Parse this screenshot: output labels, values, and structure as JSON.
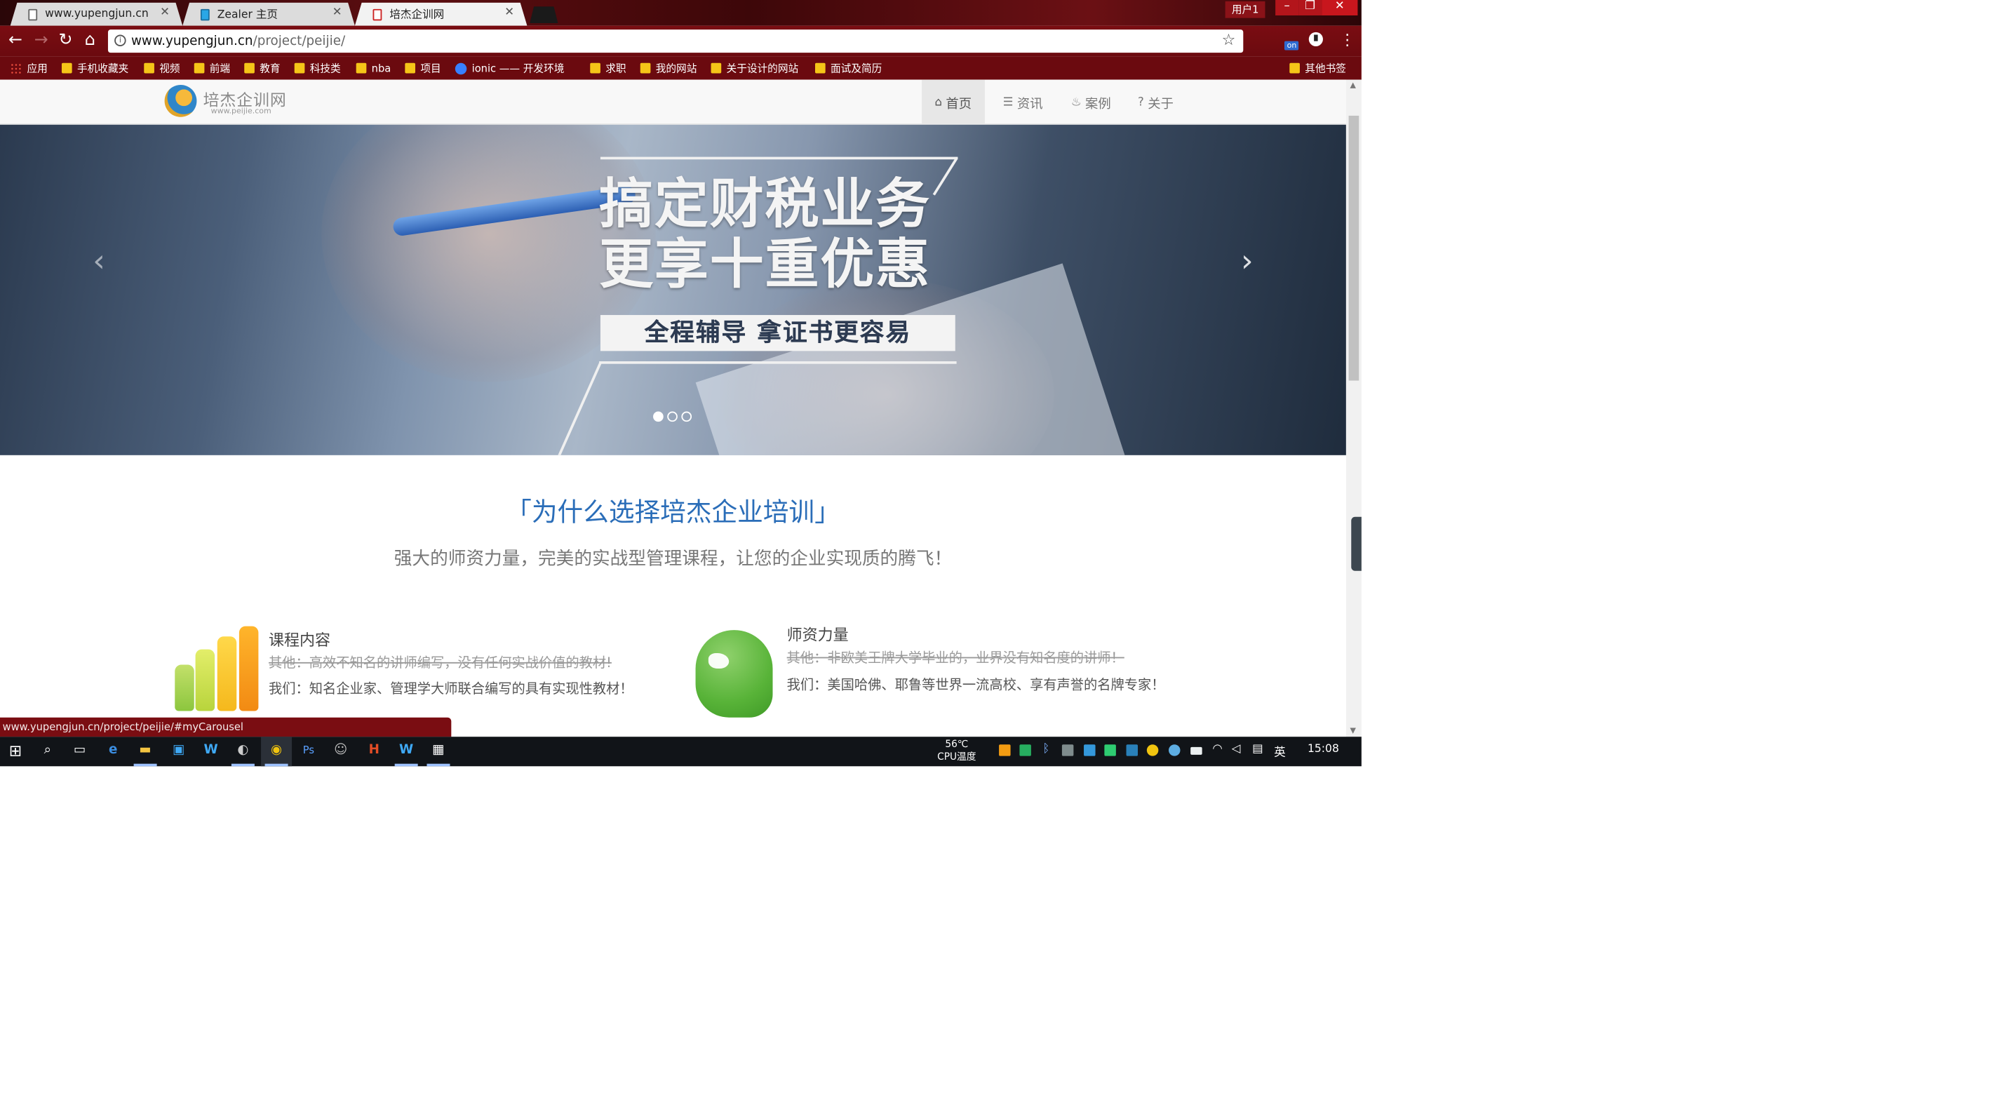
{
  "browser": {
    "tabs": [
      {
        "title": "www.yupengjun.cn",
        "active": false
      },
      {
        "title": "Zealer 主页",
        "active": false
      },
      {
        "title": "培杰企训网",
        "active": true
      }
    ],
    "user_label": "用户1",
    "address": {
      "host": "www.yupengjun.cn",
      "path": "/project/peijie/"
    },
    "extension_badge": "on",
    "bookmarks": [
      "应用",
      "手机收藏夹",
      "视频",
      "前端",
      "教育",
      "科技类",
      "nba",
      "项目",
      "ionic —— 开发环境",
      "求职",
      "我的网站",
      "关于设计的网站",
      "面试及简历",
      "其他书签"
    ],
    "status_url": "www.yupengjun.cn/project/peijie/#myCarousel"
  },
  "site": {
    "logo_text": "培杰企训网",
    "logo_url": "www.peijie.com",
    "nav": [
      {
        "icon": "home-icon",
        "glyph": "⌂",
        "label": "首页",
        "active": true
      },
      {
        "icon": "list-icon",
        "glyph": "☰",
        "label": "资讯",
        "active": false
      },
      {
        "icon": "fire-icon",
        "glyph": "♨",
        "label": "案例",
        "active": false
      },
      {
        "icon": "question-icon",
        "glyph": "?",
        "label": "关于",
        "active": false
      }
    ],
    "carousel": {
      "headline_1": "搞定财税业务",
      "headline_2": "更享十重优惠",
      "subline": "全程辅导 拿证书更容易",
      "prev_glyph": "‹",
      "next_glyph": "›",
      "slide_count": 3,
      "active_slide": 1
    },
    "section": {
      "title": "「为什么选择培杰企业培训」",
      "subtitle": "强大的师资力量，完美的实战型管理课程，让您的企业实现质的腾飞！"
    },
    "features": [
      {
        "title": "课程内容",
        "other": "其他：高效不知名的讲师编写，没有任何实战价值的教材!",
        "ours": "我们：知名企业家、管理学大师联合编写的具有实现性教材！"
      },
      {
        "title": "师资力量",
        "other": "其他：非欧美王牌大学毕业的，业界没有知名度的讲师！",
        "ours": "我们：美国哈佛、耶鲁等世界一流高校、享有声誉的名牌专家！"
      }
    ]
  },
  "taskbar": {
    "cpu_temp": "56℃",
    "cpu_label": "CPU温度",
    "ime": "英",
    "time": "15:08"
  },
  "colors": {
    "chrome_red": "#6b0a0f",
    "accent_blue": "#2a6db8",
    "taskbar": "#111418"
  }
}
